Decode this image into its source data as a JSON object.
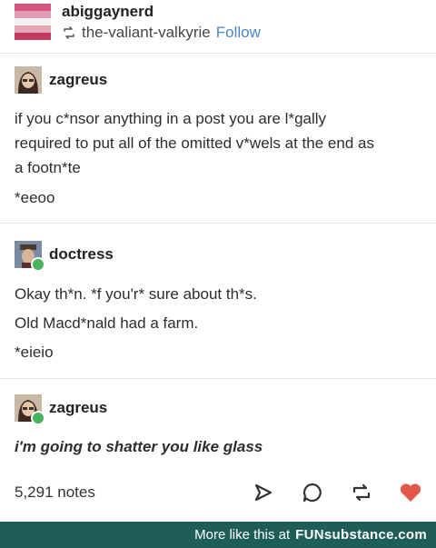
{
  "header": {
    "flag_colors": [
      "#d4567f",
      "#e19bb5",
      "#f4f1f2",
      "#e6a6b6",
      "#c03c62"
    ],
    "username": "abiggaynerd",
    "reblogged_from": "the-valiant-valkyrie",
    "follow_label": "Follow"
  },
  "posts": [
    {
      "username": "zagreus",
      "lines": [
        "if you c*nsor anything in a post you are l*gally",
        "required to put all of the omitted v*wels at the end as",
        "a footn*te",
        "*eeoo"
      ]
    },
    {
      "username": "doctress",
      "lines": [
        "Okay th*n. *f you'r* sure about th*s.",
        "Old Macd*nald had a farm.",
        "*eieio"
      ]
    },
    {
      "username": "zagreus",
      "lines": [
        "i'm going to shatter you like glass"
      ]
    }
  ],
  "footer": {
    "notes": "5,291 notes",
    "icons": [
      "share-icon",
      "reply-icon",
      "reblog-icon",
      "like-icon"
    ],
    "like_color": "#e4584a"
  },
  "banner": {
    "text": "More like this at",
    "brand_fun": "FUN",
    "brand_rest": "substance.com",
    "bg_color": "#1f5e57"
  }
}
